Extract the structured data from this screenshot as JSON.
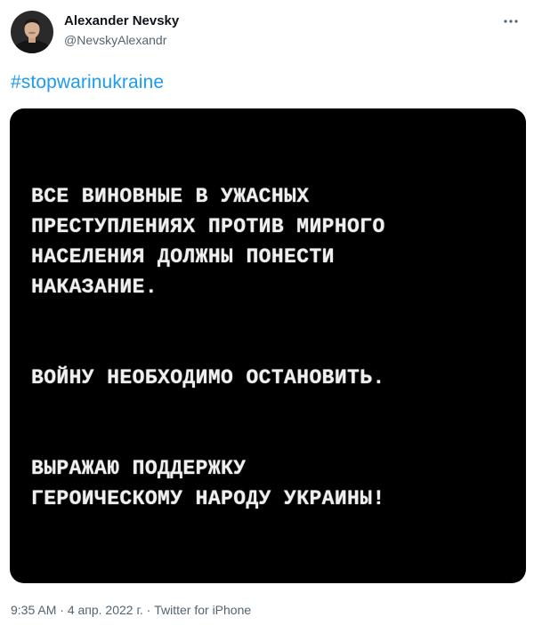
{
  "author": {
    "name": "Alexander Nevsky",
    "handle": "@NevskyAlexandr"
  },
  "tweet": {
    "hashtag": "#stopwarinukraine",
    "image_text": "ВСЕ ВИНОВНЫЕ В УЖАСНЫХ\nПРЕСТУПЛЕНИЯХ ПРОТИВ МИРНОГО\nНАСЕЛЕНИЯ ДОЛЖНЫ ПОНЕСТИ\nНАКАЗАНИЕ.\n\n\nВОЙНУ НЕОБХОДИМО ОСТАНОВИТЬ.\n\n\nВЫРАЖАЮ ПОДДЕРЖКУ\nГЕРОИЧЕСКОМУ НАРОДУ УКРАИНЫ!"
  },
  "meta": {
    "time": "9:35 AM",
    "separator": " · ",
    "date": "4 апр. 2022 г.",
    "source": "Twitter for iPhone"
  },
  "icons": {
    "more": "more-horizontal-icon"
  },
  "colors": {
    "link": "#1d9bf0",
    "secondary_text": "#536471",
    "primary_text": "#0f1419",
    "media_background": "#000000"
  }
}
